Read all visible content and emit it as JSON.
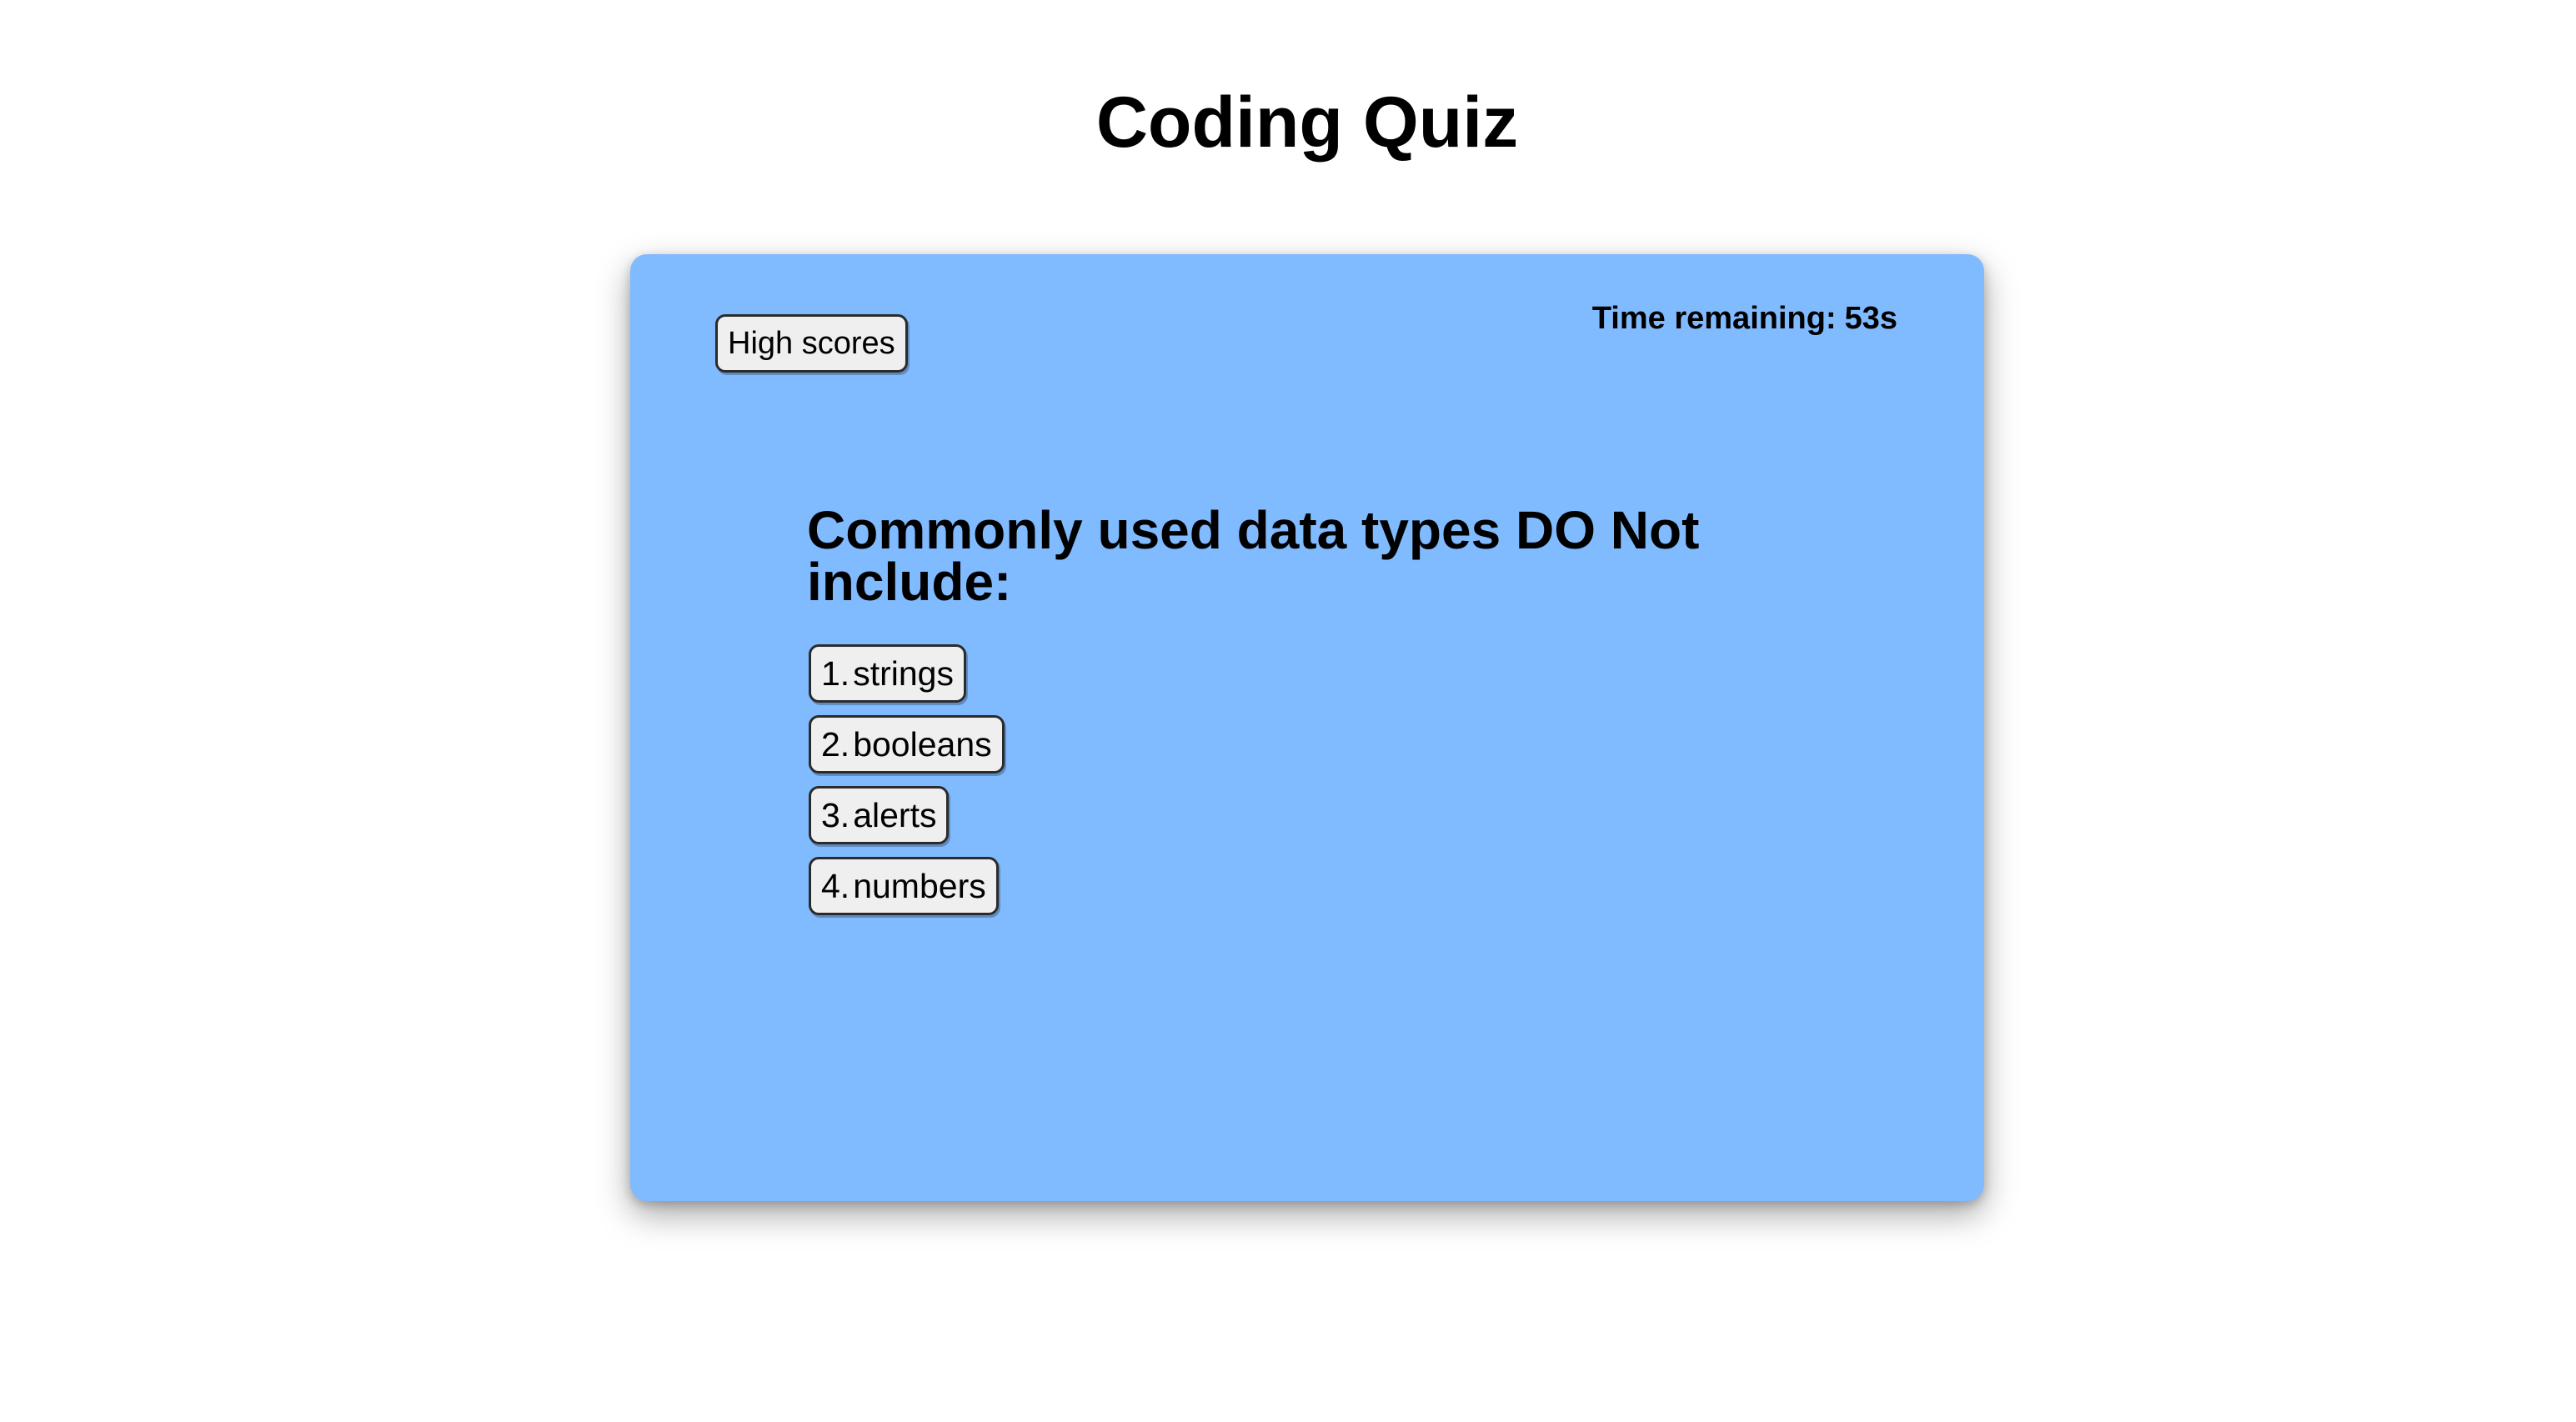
{
  "page": {
    "title": "Coding Quiz"
  },
  "card": {
    "high_scores_label": "High scores",
    "timer": {
      "label": "Time remaining:",
      "value": "53s"
    },
    "question": "Commonly used data types DO Not include:",
    "answers": [
      {
        "number": "1.",
        "text": "strings"
      },
      {
        "number": "2.",
        "text": "booleans"
      },
      {
        "number": "3.",
        "text": "alerts"
      },
      {
        "number": "4.",
        "text": "numbers"
      }
    ]
  },
  "colors": {
    "card_background": "#80baff",
    "button_background": "#efefef",
    "page_background": "#ffffff"
  }
}
